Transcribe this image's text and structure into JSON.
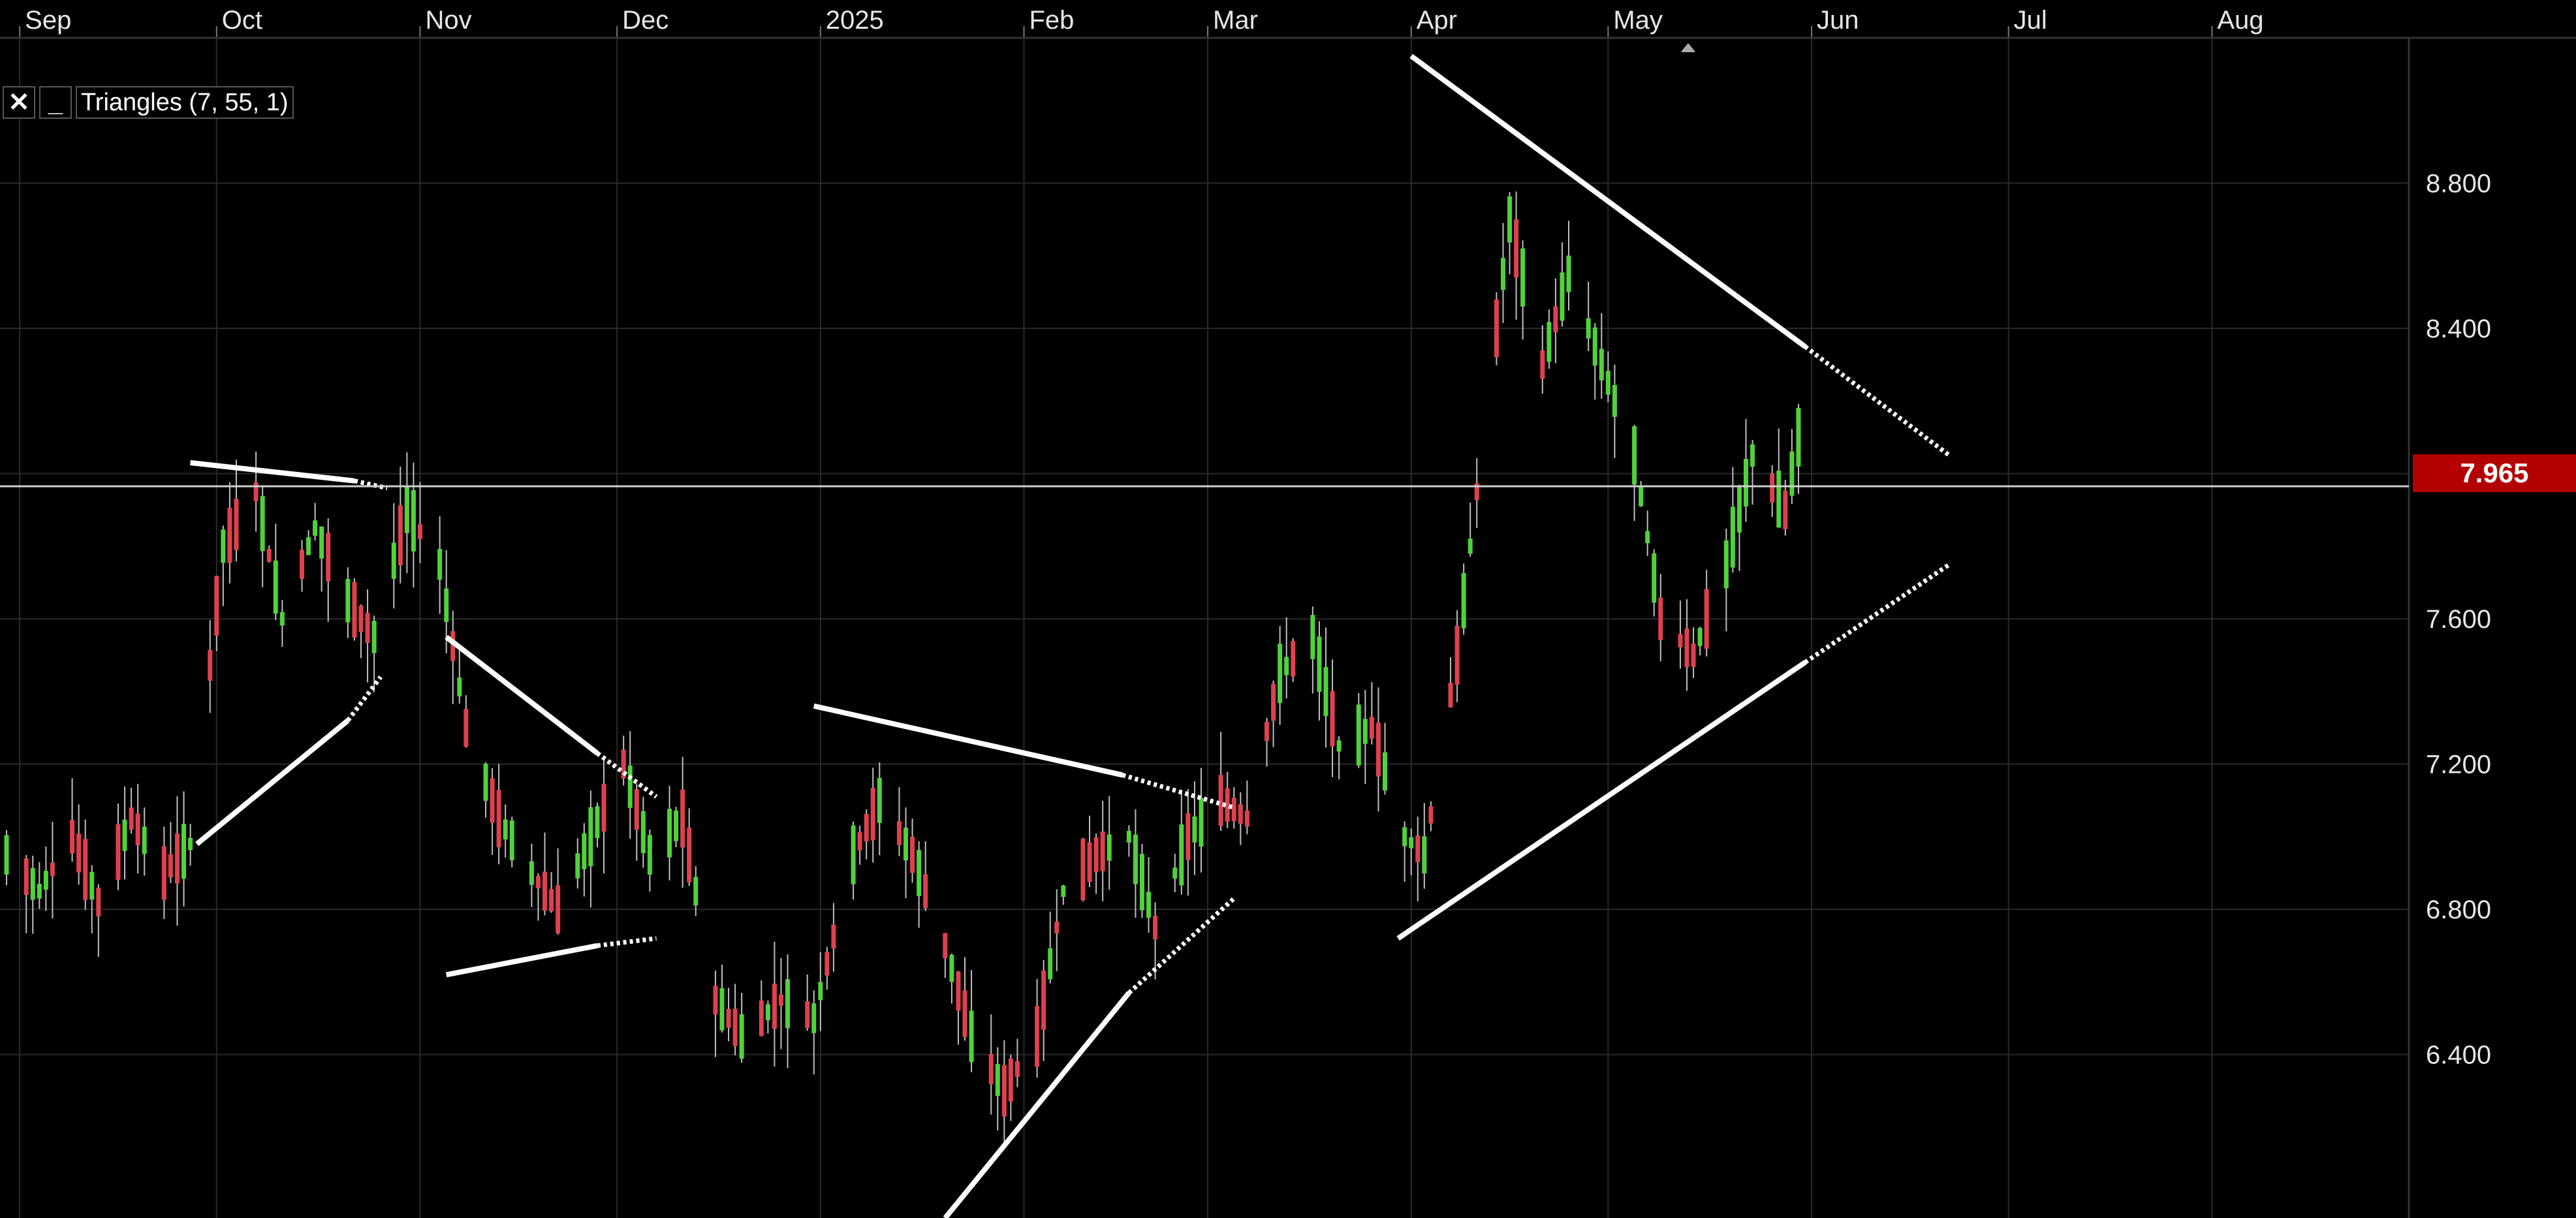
{
  "indicator": {
    "close_label": "✕",
    "minimize_label": "_",
    "name": "Triangles (7, 55, 1)"
  },
  "last_price": "7.965",
  "colors": {
    "background": "#000000",
    "up_bar": "#4fd23a",
    "down_bar": "#e0404e",
    "neutral_wick": "#bfbfbf",
    "grid": "#2a2a2a",
    "pattern_line": "#ffffff",
    "price_tag": "#b30000"
  },
  "chart_data": {
    "type": "ohlc_candlestick",
    "x_axis": {
      "type": "date",
      "range": [
        "2024-08-29",
        "2025-08-31"
      ],
      "ticks": [
        {
          "date": "2024-09-01",
          "label": "Sep"
        },
        {
          "date": "2024-10-01",
          "label": "Oct"
        },
        {
          "date": "2024-11-01",
          "label": "Nov"
        },
        {
          "date": "2024-12-01",
          "label": "Dec"
        },
        {
          "date": "2025-01-01",
          "label": "2025"
        },
        {
          "date": "2025-02-01",
          "label": "Feb"
        },
        {
          "date": "2025-03-01",
          "label": "Mar"
        },
        {
          "date": "2025-04-01",
          "label": "Apr"
        },
        {
          "date": "2025-05-01",
          "label": "May"
        },
        {
          "date": "2025-06-01",
          "label": "Jun"
        },
        {
          "date": "2025-07-01",
          "label": "Jul"
        },
        {
          "date": "2025-08-01",
          "label": "Aug"
        }
      ]
    },
    "y_axis": {
      "position": "right",
      "range": [
        5.95,
        9.2
      ],
      "ticks": [
        6.4,
        6.8,
        7.2,
        7.6,
        8.0,
        8.4,
        8.8
      ],
      "tick_labels": [
        "6.400",
        "6.800",
        "7.200",
        "7.600",
        "8.000",
        "8.400",
        "8.800"
      ]
    },
    "grid": true,
    "last_price": 7.965,
    "price_series": [
      [
        "2024-08-30",
        6.95
      ],
      [
        "2024-09-04",
        6.85
      ],
      [
        "2024-09-09",
        7.0
      ],
      [
        "2024-09-13",
        6.82
      ],
      [
        "2024-09-18",
        7.05
      ],
      [
        "2024-09-23",
        6.9
      ],
      [
        "2024-09-27",
        6.98
      ],
      [
        "2024-10-02",
        7.8
      ],
      [
        "2024-10-07",
        7.95
      ],
      [
        "2024-10-11",
        7.6
      ],
      [
        "2024-10-16",
        7.85
      ],
      [
        "2024-10-21",
        7.65
      ],
      [
        "2024-10-25",
        7.55
      ],
      [
        "2024-10-30",
        7.9
      ],
      [
        "2024-11-04",
        7.75
      ],
      [
        "2024-11-08",
        7.3
      ],
      [
        "2024-11-13",
        7.05
      ],
      [
        "2024-11-18",
        6.9
      ],
      [
        "2024-11-22",
        6.8
      ],
      [
        "2024-11-27",
        7.0
      ],
      [
        "2024-12-02",
        7.2
      ],
      [
        "2024-12-06",
        6.95
      ],
      [
        "2024-12-11",
        7.05
      ],
      [
        "2024-12-16",
        6.55
      ],
      [
        "2024-12-20",
        6.45
      ],
      [
        "2024-12-26",
        6.55
      ],
      [
        "2024-12-31",
        6.5
      ],
      [
        "2025-01-06",
        6.95
      ],
      [
        "2025-01-10",
        7.1
      ],
      [
        "2025-01-15",
        6.95
      ],
      [
        "2025-01-20",
        6.7
      ],
      [
        "2025-01-24",
        6.45
      ],
      [
        "2025-01-29",
        6.3
      ],
      [
        "2025-02-03",
        6.45
      ],
      [
        "2025-02-07",
        6.85
      ],
      [
        "2025-02-12",
        6.95
      ],
      [
        "2025-02-17",
        7.0
      ],
      [
        "2025-02-21",
        6.75
      ],
      [
        "2025-02-26",
        7.0
      ],
      [
        "2025-03-03",
        7.1
      ],
      [
        "2025-03-07",
        7.05
      ],
      [
        "2025-03-12",
        7.45
      ],
      [
        "2025-03-17",
        7.55
      ],
      [
        "2025-03-21",
        7.25
      ],
      [
        "2025-03-26",
        7.3
      ],
      [
        "2025-03-31",
        7.0
      ],
      [
        "2025-04-03",
        6.95
      ],
      [
        "2025-04-08",
        7.5
      ],
      [
        "2025-04-11",
        7.95
      ],
      [
        "2025-04-16",
        8.7
      ],
      [
        "2025-04-21",
        8.3
      ],
      [
        "2025-04-25",
        8.55
      ],
      [
        "2025-04-30",
        8.3
      ],
      [
        "2025-05-05",
        8.05
      ],
      [
        "2025-05-09",
        7.6
      ],
      [
        "2025-05-14",
        7.5
      ],
      [
        "2025-05-19",
        7.75
      ],
      [
        "2025-05-23",
        8.05
      ],
      [
        "2025-05-28",
        7.9
      ],
      [
        "2025-05-30",
        8.1
      ]
    ],
    "annotations": [
      {
        "type": "line",
        "style": "solid",
        "from": [
          "2024-09-27",
          8.03
        ],
        "to": [
          "2024-10-22",
          7.98
        ]
      },
      {
        "type": "line",
        "style": "dotted",
        "from": [
          "2024-10-22",
          7.98
        ],
        "to": [
          "2024-10-27",
          7.96
        ]
      },
      {
        "type": "line",
        "style": "solid",
        "from": [
          "2024-09-28",
          6.98
        ],
        "to": [
          "2024-10-21",
          7.32
        ]
      },
      {
        "type": "line",
        "style": "dotted",
        "from": [
          "2024-10-21",
          7.32
        ],
        "to": [
          "2024-10-26",
          7.44
        ]
      },
      {
        "type": "line",
        "style": "solid",
        "from": [
          "2024-11-05",
          7.55
        ],
        "to": [
          "2024-11-28",
          7.23
        ]
      },
      {
        "type": "line",
        "style": "dotted",
        "from": [
          "2024-11-28",
          7.23
        ],
        "to": [
          "2024-12-07",
          7.11
        ]
      },
      {
        "type": "line",
        "style": "solid",
        "from": [
          "2024-11-05",
          6.62
        ],
        "to": [
          "2024-11-28",
          6.7
        ]
      },
      {
        "type": "line",
        "style": "dotted",
        "from": [
          "2024-11-28",
          6.7
        ],
        "to": [
          "2024-12-07",
          6.72
        ]
      },
      {
        "type": "line",
        "style": "solid",
        "from": [
          "2024-12-31",
          7.36
        ],
        "to": [
          "2025-02-16",
          7.17
        ]
      },
      {
        "type": "line",
        "style": "dotted",
        "from": [
          "2025-02-16",
          7.17
        ],
        "to": [
          "2025-03-05",
          7.08
        ]
      },
      {
        "type": "line",
        "style": "solid",
        "from": [
          "2025-01-20",
          5.95
        ],
        "to": [
          "2025-02-17",
          6.57
        ]
      },
      {
        "type": "line",
        "style": "dotted",
        "from": [
          "2025-02-17",
          6.57
        ],
        "to": [
          "2025-03-05",
          6.83
        ]
      },
      {
        "type": "line",
        "style": "solid",
        "from": [
          "2025-04-01",
          9.15
        ],
        "to": [
          "2025-05-31",
          8.35
        ]
      },
      {
        "type": "line",
        "style": "dotted",
        "from": [
          "2025-05-31",
          8.35
        ],
        "to": [
          "2025-06-22",
          8.05
        ]
      },
      {
        "type": "line",
        "style": "solid",
        "from": [
          "2025-03-30",
          6.72
        ],
        "to": [
          "2025-05-31",
          7.48
        ]
      },
      {
        "type": "line",
        "style": "dotted",
        "from": [
          "2025-05-31",
          7.48
        ],
        "to": [
          "2025-06-22",
          7.75
        ]
      }
    ]
  }
}
